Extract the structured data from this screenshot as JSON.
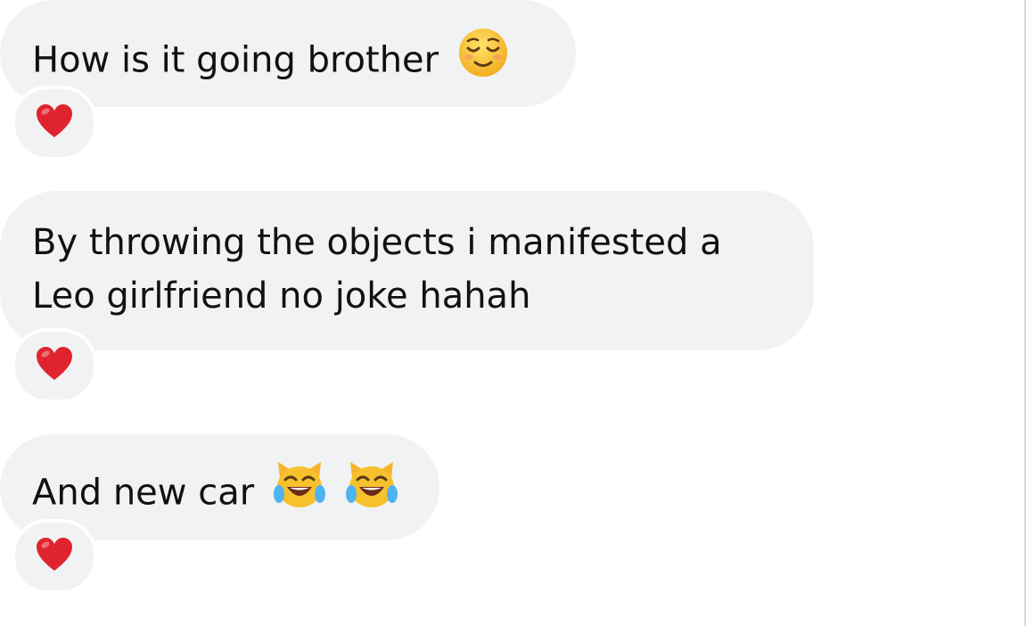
{
  "messages": [
    {
      "lines": [
        "How is it going brother"
      ],
      "emoji_icons": [
        "relieved-face-icon"
      ],
      "reaction": "heart-icon"
    },
    {
      "lines": [
        "By throwing the objects i manifested a",
        "Leo girlfriend no joke hahah"
      ],
      "emoji_icons": [],
      "reaction": "heart-icon"
    },
    {
      "lines": [
        "And new car"
      ],
      "emoji_icons": [
        "cat-tears-of-joy-icon",
        "cat-tears-of-joy-icon"
      ],
      "reaction": "heart-icon"
    }
  ],
  "colors": {
    "bubble": "#f1f2f4",
    "text": "#111111",
    "heart": "#e0242f",
    "emoji_yellow": "#f7c12e"
  }
}
